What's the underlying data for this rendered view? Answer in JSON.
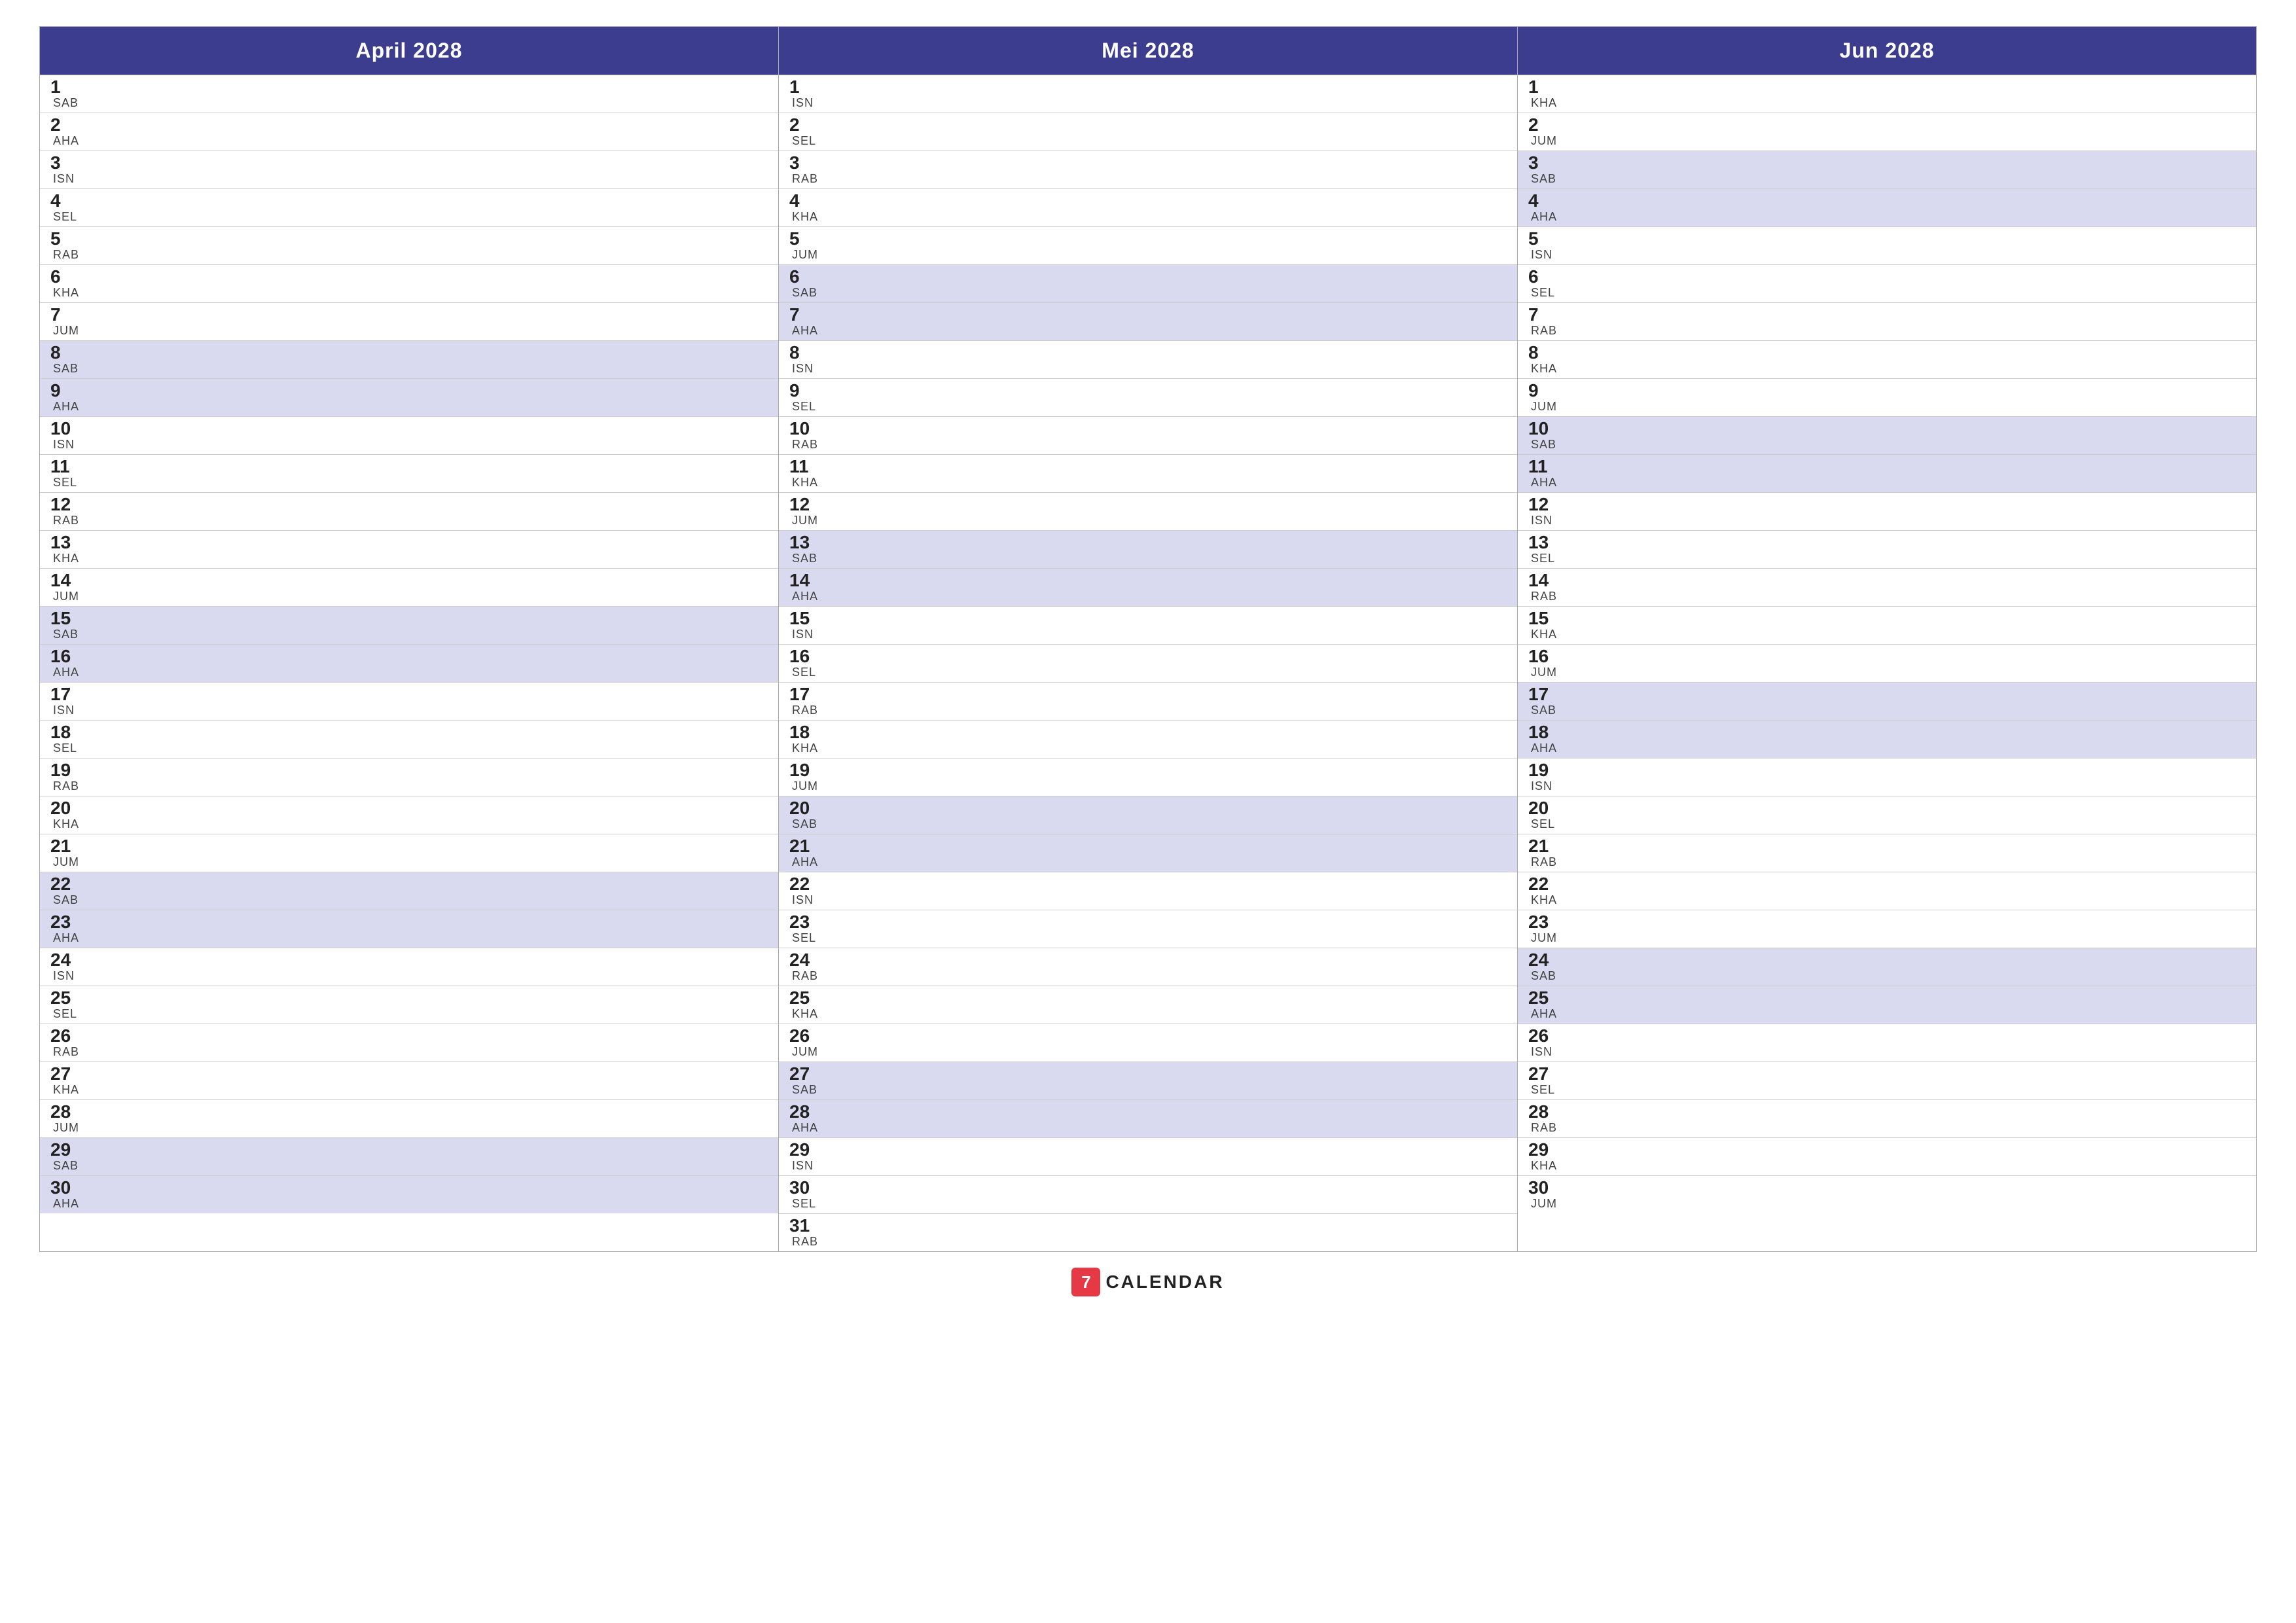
{
  "months": [
    {
      "title": "April 2028",
      "days": [
        {
          "num": "1",
          "name": "SAB",
          "highlight": false
        },
        {
          "num": "2",
          "name": "AHA",
          "highlight": false
        },
        {
          "num": "3",
          "name": "ISN",
          "highlight": false
        },
        {
          "num": "4",
          "name": "SEL",
          "highlight": false
        },
        {
          "num": "5",
          "name": "RAB",
          "highlight": false
        },
        {
          "num": "6",
          "name": "KHA",
          "highlight": false
        },
        {
          "num": "7",
          "name": "JUM",
          "highlight": false
        },
        {
          "num": "8",
          "name": "SAB",
          "highlight": true
        },
        {
          "num": "9",
          "name": "AHA",
          "highlight": true
        },
        {
          "num": "10",
          "name": "ISN",
          "highlight": false
        },
        {
          "num": "11",
          "name": "SEL",
          "highlight": false
        },
        {
          "num": "12",
          "name": "RAB",
          "highlight": false
        },
        {
          "num": "13",
          "name": "KHA",
          "highlight": false
        },
        {
          "num": "14",
          "name": "JUM",
          "highlight": false
        },
        {
          "num": "15",
          "name": "SAB",
          "highlight": true
        },
        {
          "num": "16",
          "name": "AHA",
          "highlight": true
        },
        {
          "num": "17",
          "name": "ISN",
          "highlight": false
        },
        {
          "num": "18",
          "name": "SEL",
          "highlight": false
        },
        {
          "num": "19",
          "name": "RAB",
          "highlight": false
        },
        {
          "num": "20",
          "name": "KHA",
          "highlight": false
        },
        {
          "num": "21",
          "name": "JUM",
          "highlight": false
        },
        {
          "num": "22",
          "name": "SAB",
          "highlight": true
        },
        {
          "num": "23",
          "name": "AHA",
          "highlight": true
        },
        {
          "num": "24",
          "name": "ISN",
          "highlight": false
        },
        {
          "num": "25",
          "name": "SEL",
          "highlight": false
        },
        {
          "num": "26",
          "name": "RAB",
          "highlight": false
        },
        {
          "num": "27",
          "name": "KHA",
          "highlight": false
        },
        {
          "num": "28",
          "name": "JUM",
          "highlight": false
        },
        {
          "num": "29",
          "name": "SAB",
          "highlight": true
        },
        {
          "num": "30",
          "name": "AHA",
          "highlight": true
        }
      ]
    },
    {
      "title": "Mei 2028",
      "days": [
        {
          "num": "1",
          "name": "ISN",
          "highlight": false
        },
        {
          "num": "2",
          "name": "SEL",
          "highlight": false
        },
        {
          "num": "3",
          "name": "RAB",
          "highlight": false
        },
        {
          "num": "4",
          "name": "KHA",
          "highlight": false
        },
        {
          "num": "5",
          "name": "JUM",
          "highlight": false
        },
        {
          "num": "6",
          "name": "SAB",
          "highlight": true
        },
        {
          "num": "7",
          "name": "AHA",
          "highlight": true
        },
        {
          "num": "8",
          "name": "ISN",
          "highlight": false
        },
        {
          "num": "9",
          "name": "SEL",
          "highlight": false
        },
        {
          "num": "10",
          "name": "RAB",
          "highlight": false
        },
        {
          "num": "11",
          "name": "KHA",
          "highlight": false
        },
        {
          "num": "12",
          "name": "JUM",
          "highlight": false
        },
        {
          "num": "13",
          "name": "SAB",
          "highlight": true
        },
        {
          "num": "14",
          "name": "AHA",
          "highlight": true
        },
        {
          "num": "15",
          "name": "ISN",
          "highlight": false
        },
        {
          "num": "16",
          "name": "SEL",
          "highlight": false
        },
        {
          "num": "17",
          "name": "RAB",
          "highlight": false
        },
        {
          "num": "18",
          "name": "KHA",
          "highlight": false
        },
        {
          "num": "19",
          "name": "JUM",
          "highlight": false
        },
        {
          "num": "20",
          "name": "SAB",
          "highlight": true
        },
        {
          "num": "21",
          "name": "AHA",
          "highlight": true
        },
        {
          "num": "22",
          "name": "ISN",
          "highlight": false
        },
        {
          "num": "23",
          "name": "SEL",
          "highlight": false
        },
        {
          "num": "24",
          "name": "RAB",
          "highlight": false
        },
        {
          "num": "25",
          "name": "KHA",
          "highlight": false
        },
        {
          "num": "26",
          "name": "JUM",
          "highlight": false
        },
        {
          "num": "27",
          "name": "SAB",
          "highlight": true
        },
        {
          "num": "28",
          "name": "AHA",
          "highlight": true
        },
        {
          "num": "29",
          "name": "ISN",
          "highlight": false
        },
        {
          "num": "30",
          "name": "SEL",
          "highlight": false
        },
        {
          "num": "31",
          "name": "RAB",
          "highlight": false
        }
      ]
    },
    {
      "title": "Jun 2028",
      "days": [
        {
          "num": "1",
          "name": "KHA",
          "highlight": false
        },
        {
          "num": "2",
          "name": "JUM",
          "highlight": false
        },
        {
          "num": "3",
          "name": "SAB",
          "highlight": true
        },
        {
          "num": "4",
          "name": "AHA",
          "highlight": true
        },
        {
          "num": "5",
          "name": "ISN",
          "highlight": false
        },
        {
          "num": "6",
          "name": "SEL",
          "highlight": false
        },
        {
          "num": "7",
          "name": "RAB",
          "highlight": false
        },
        {
          "num": "8",
          "name": "KHA",
          "highlight": false
        },
        {
          "num": "9",
          "name": "JUM",
          "highlight": false
        },
        {
          "num": "10",
          "name": "SAB",
          "highlight": true
        },
        {
          "num": "11",
          "name": "AHA",
          "highlight": true
        },
        {
          "num": "12",
          "name": "ISN",
          "highlight": false
        },
        {
          "num": "13",
          "name": "SEL",
          "highlight": false
        },
        {
          "num": "14",
          "name": "RAB",
          "highlight": false
        },
        {
          "num": "15",
          "name": "KHA",
          "highlight": false
        },
        {
          "num": "16",
          "name": "JUM",
          "highlight": false
        },
        {
          "num": "17",
          "name": "SAB",
          "highlight": true
        },
        {
          "num": "18",
          "name": "AHA",
          "highlight": true
        },
        {
          "num": "19",
          "name": "ISN",
          "highlight": false
        },
        {
          "num": "20",
          "name": "SEL",
          "highlight": false
        },
        {
          "num": "21",
          "name": "RAB",
          "highlight": false
        },
        {
          "num": "22",
          "name": "KHA",
          "highlight": false
        },
        {
          "num": "23",
          "name": "JUM",
          "highlight": false
        },
        {
          "num": "24",
          "name": "SAB",
          "highlight": true
        },
        {
          "num": "25",
          "name": "AHA",
          "highlight": true
        },
        {
          "num": "26",
          "name": "ISN",
          "highlight": false
        },
        {
          "num": "27",
          "name": "SEL",
          "highlight": false
        },
        {
          "num": "28",
          "name": "RAB",
          "highlight": false
        },
        {
          "num": "29",
          "name": "KHA",
          "highlight": false
        },
        {
          "num": "30",
          "name": "JUM",
          "highlight": false
        }
      ]
    }
  ],
  "footer": {
    "logo_number": "7",
    "logo_text": "CALENDAR"
  }
}
